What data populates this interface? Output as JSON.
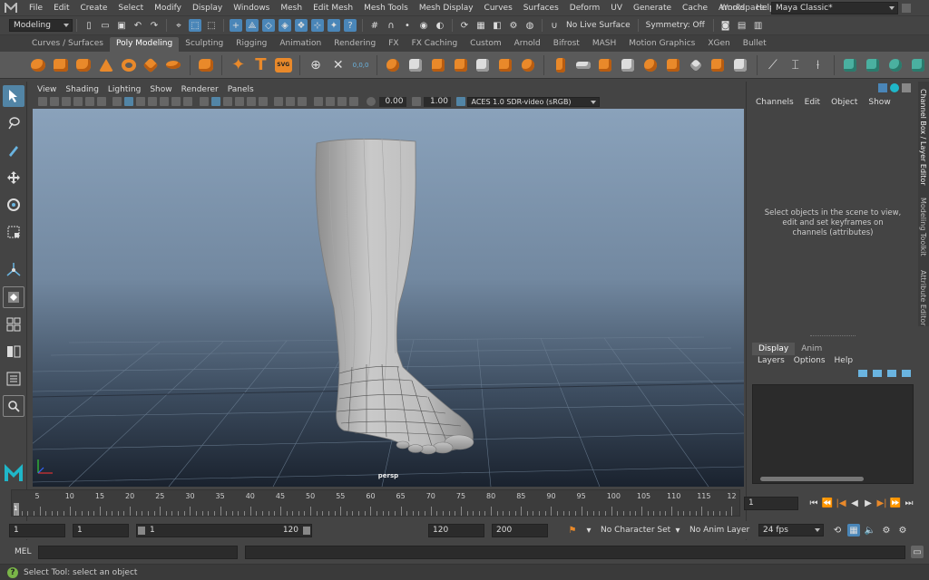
{
  "menubar": {
    "items": [
      "File",
      "Edit",
      "Create",
      "Select",
      "Modify",
      "Display",
      "Windows",
      "Mesh",
      "Edit Mesh",
      "Mesh Tools",
      "Mesh Display",
      "Curves",
      "Surfaces",
      "Deform",
      "UV",
      "Generate",
      "Cache",
      "Arnold",
      "Help"
    ],
    "workspace_label": "Workspace:",
    "workspace_value": "Maya Classic*"
  },
  "statusline": {
    "mode": "Modeling",
    "live_surface": "No Live Surface",
    "symmetry": "Symmetry: Off"
  },
  "shelf": {
    "tabs": [
      "Curves / Surfaces",
      "Poly Modeling",
      "Sculpting",
      "Rigging",
      "Animation",
      "Rendering",
      "FX",
      "FX Caching",
      "Custom",
      "Arnold",
      "Bifrost",
      "MASH",
      "Motion Graphics",
      "XGen",
      "Bullet"
    ],
    "active_tab": "Poly Modeling",
    "text_icon": "T",
    "svg_icon": "SVG",
    "counter_icon": "0,0,0"
  },
  "viewport": {
    "menu": [
      "View",
      "Shading",
      "Lighting",
      "Show",
      "Renderer",
      "Panels"
    ],
    "exposure": "0.00",
    "gamma": "1.00",
    "color_space": "ACES 1.0 SDR-video (sRGB)",
    "camera": "persp"
  },
  "channelbox": {
    "menu": [
      "Channels",
      "Edit",
      "Object",
      "Show"
    ],
    "message_line1": "Select objects in the scene to view,",
    "message_line2": "edit and set keyframes on",
    "message_line3": "channels (attributes)",
    "layer_tabs": [
      "Display",
      "Anim"
    ],
    "layer_menu": [
      "Layers",
      "Options",
      "Help"
    ]
  },
  "side_tabs": [
    "Channel Box / Layer Editor",
    "Modeling Toolkit",
    "Attribute Editor"
  ],
  "timeslider": {
    "ticks": [
      5,
      10,
      15,
      20,
      25,
      30,
      35,
      40,
      45,
      50,
      55,
      60,
      65,
      70,
      75,
      80,
      85,
      90,
      95,
      100,
      105,
      110,
      115,
      12
    ],
    "current_marker": "1",
    "current_frame": "1"
  },
  "rangebar": {
    "start": "1",
    "playback_start": "1",
    "range_start": "1",
    "range_end": "120",
    "playback_end": "120",
    "end": "200",
    "character_set": "No Character Set",
    "anim_layer": "No Anim Layer",
    "fps": "24 fps"
  },
  "cmdline": {
    "label": "MEL"
  },
  "helpline": {
    "text": "Select Tool: select an object"
  },
  "colors": {
    "accent": "#5285a6",
    "shelf_orange": "#e9892a",
    "logo_teal": "#1fb7c9"
  }
}
